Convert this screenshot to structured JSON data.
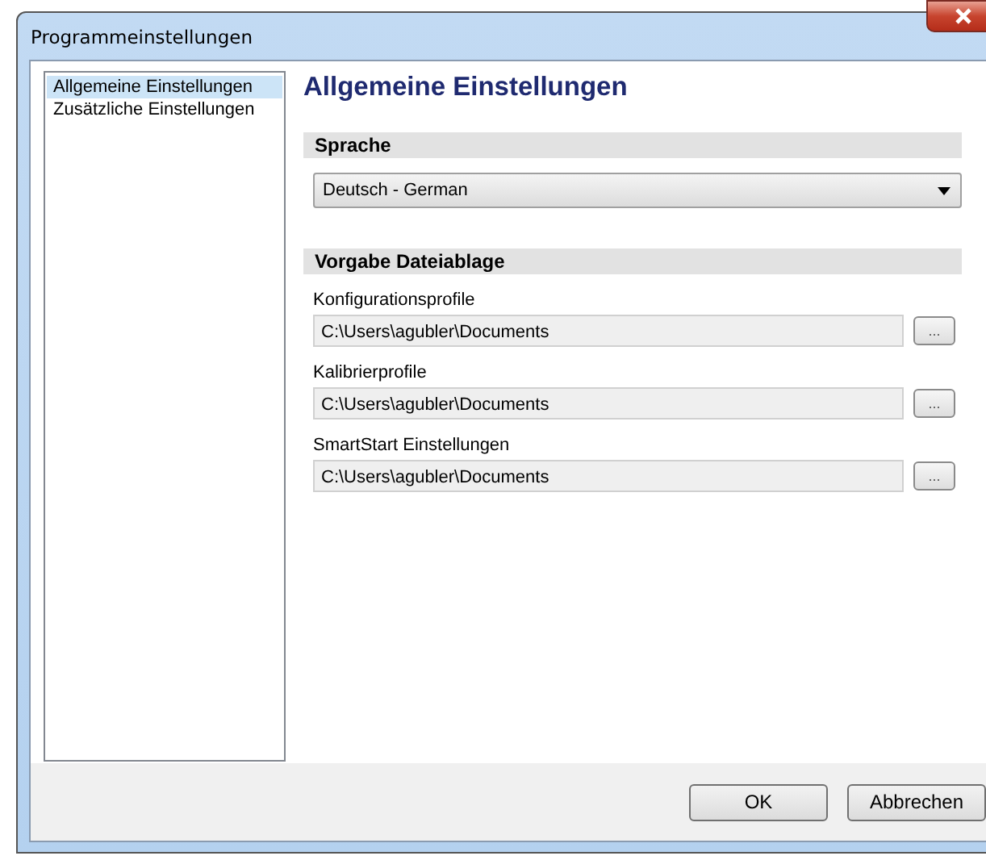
{
  "window": {
    "title": "Programmeinstellungen"
  },
  "sidebar": {
    "items": [
      {
        "label": "Allgemeine Einstellungen",
        "selected": true
      },
      {
        "label": "Zusätzliche Einstellungen",
        "selected": false
      }
    ]
  },
  "page": {
    "title": "Allgemeine Einstellungen",
    "language_section": {
      "heading": "Sprache",
      "dropdown_value": "Deutsch  -  German"
    },
    "storage_section": {
      "heading": "Vorgabe Dateiablage",
      "paths": [
        {
          "label": "Konfigurationsprofile",
          "value": "C:\\Users\\agubler\\Documents",
          "browse": "..."
        },
        {
          "label": "Kalibrierprofile",
          "value": "C:\\Users\\agubler\\Documents",
          "browse": "..."
        },
        {
          "label": "SmartStart Einstellungen",
          "value": "C:\\Users\\agubler\\Documents",
          "browse": "..."
        }
      ]
    }
  },
  "buttons": [
    "OK",
    "Abbrechen"
  ]
}
